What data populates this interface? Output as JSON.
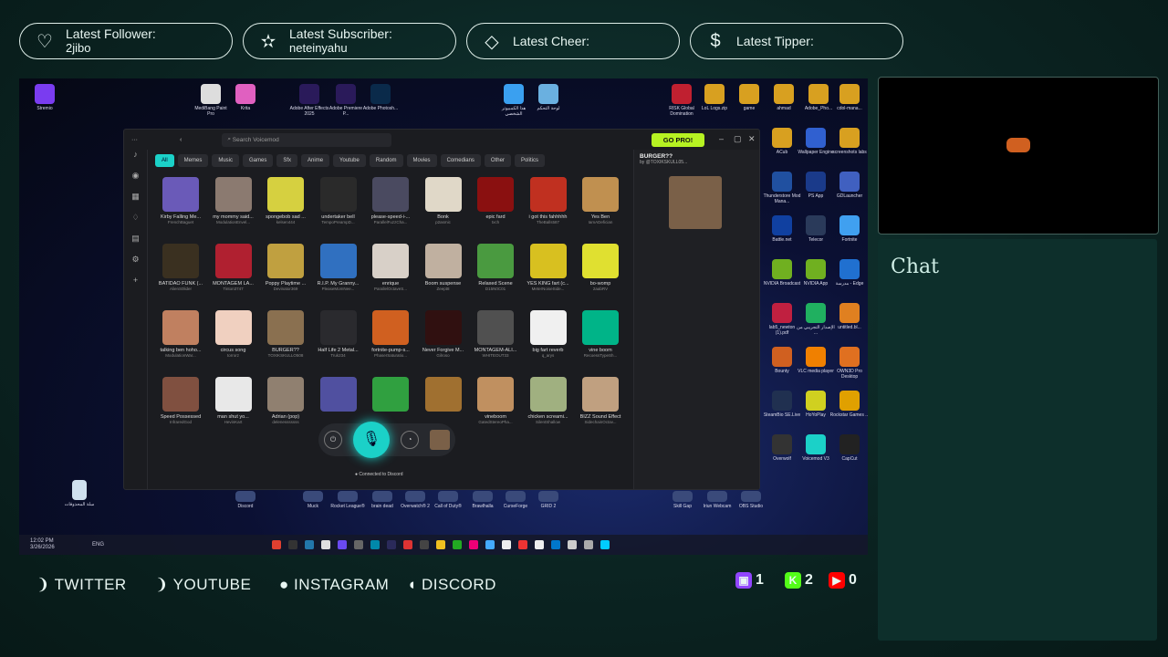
{
  "alerts": [
    {
      "icon": "heart-icon",
      "label": "Latest Follower:",
      "value": "2jibo",
      "glyph": "♡"
    },
    {
      "icon": "star-icon",
      "label": "Latest Subscriber:",
      "value": "neteinyahu",
      "glyph": "✫"
    },
    {
      "icon": "diamond-icon",
      "label": "Latest Cheer:",
      "value": "",
      "glyph": "◇"
    },
    {
      "icon": "dollar-icon",
      "label": "Latest Tipper:",
      "value": "",
      "glyph": "$"
    }
  ],
  "chat_label": "Chat",
  "socials": [
    {
      "icon": "twitter-icon",
      "glyph": "❩",
      "label": "TWITTER"
    },
    {
      "icon": "youtube-icon",
      "glyph": "❩",
      "label": "YOUTUBE"
    },
    {
      "icon": "instagram-icon",
      "glyph": "●",
      "label": "INSTAGRAM"
    },
    {
      "icon": "discord-icon",
      "glyph": "◖",
      "label": "DISCORD"
    }
  ],
  "counts": [
    {
      "icon": "twitch-icon",
      "value": "1",
      "color": "#9146ff"
    },
    {
      "icon": "kick-icon",
      "value": "2",
      "color": "#53fc18"
    },
    {
      "icon": "youtube-icon",
      "value": "0",
      "color": "#ff0000"
    }
  ],
  "desktop": {
    "top_icons": [
      "Stremio",
      "MediBang Paint Pro",
      "Krita",
      "Adobe After Effects 2025",
      "Adobe Premiere P...",
      "Adobe Photosh...",
      "هذا الكمبيوتر الشخصي",
      "لوحة التحكم",
      "RISK Global Domination",
      "LoL Logs.zip",
      "game",
      "ahmad",
      "Adobe_Pho...",
      "cdol-mana..."
    ],
    "right_icons": [
      "ACub",
      "Wallpaper Engine",
      "screenshots labs",
      "Thunderstore Mod Mana...",
      "PS App",
      "GDLauncher",
      "Battle.net",
      "Telecor",
      "Fortnite",
      "NVIDIA Broadcast",
      "NVIDIA App",
      "مدرسة - Edge",
      "lab5_newton (1).pdf",
      "الإصدار التجريبي من ...",
      "untitled.bl...",
      "Bounty",
      "VLC media player",
      "OWN3D Pro Desktop",
      "SteamBio SE.Live",
      "HoYoPlay",
      "Rockstar Games ...",
      "Overwolf",
      "Voicemod V3",
      "CapCut"
    ],
    "bottom_icons": [
      "Discord",
      "Muck",
      "Rocket League®",
      "brain dead",
      "Overwatch® 2",
      "Call of Duty®",
      "Brawlhalla",
      "CurseForge",
      "GRID 2",
      "Skill Gap",
      "Iriun Webcam",
      "OBS Studio"
    ],
    "recycle": "سلة المحذوفات",
    "clock": "12:02 PM",
    "date": "3/26/2026",
    "lang": "ENG"
  },
  "voicemod": {
    "search_placeholder": "Search Voicemod",
    "go_pro": "GO PRO!",
    "categories": [
      "All",
      "Memes",
      "Music",
      "Games",
      "Sfx",
      "Anime",
      "Youtube",
      "Random",
      "Movies",
      "Comedians",
      "Other",
      "Politics"
    ],
    "sounds": [
      {
        "name": "Kirby Falling Me...",
        "author": "FrenchBaguet",
        "color": "#6a5ab8"
      },
      {
        "name": "my mommy said...",
        "author": "ModulationEnvel...",
        "color": "#8b7a70"
      },
      {
        "name": "spongebob sad ...",
        "author": "kelsen444",
        "color": "#d6d040"
      },
      {
        "name": "undertaker bell",
        "author": "TempoPreampD...",
        "color": "#2a2a2a"
      },
      {
        "name": "please-speed-i-...",
        "author": "ParallelFuzzCha...",
        "color": "#4a4a60"
      },
      {
        "name": "Bonk",
        "author": "p2asmic",
        "color": "#e0d8c8"
      },
      {
        "name": "epic fard",
        "author": "txch",
        "color": "#8a1010"
      },
      {
        "name": "i got this fahhhhh",
        "author": "TheBalls587",
        "color": "#c03020"
      },
      {
        "name": "Yes Ben",
        "author": "IamADefician",
        "color": "#c09050"
      },
      {
        "name": "BATIDAO FUNK (...",
        "author": "AlienS0lider",
        "color": "#3a3020"
      },
      {
        "name": "MONTAGEM LA...",
        "author": "Tinton3747",
        "color": "#b02030"
      },
      {
        "name": "Poppy Playtime ...",
        "author": "Devinator369",
        "color": "#c0a040"
      },
      {
        "name": "R.I.P. My Granny...",
        "author": "PleaseMomNee...",
        "color": "#3070c0"
      },
      {
        "name": "enrique",
        "author": "ParallelOctaveS...",
        "color": "#d8d0c8"
      },
      {
        "name": "Boom suspense",
        "author": "Zeept8",
        "color": "#c0b0a0"
      },
      {
        "name": "Relaxed Scene",
        "author": "D15N0C01",
        "color": "#4a9a40"
      },
      {
        "name": "YES KING fart (c...",
        "author": "MeterNoiseSide...",
        "color": "#d8c020"
      },
      {
        "name": "bo-womp",
        "author": "2aabRV",
        "color": "#e0e030"
      },
      {
        "name": "talking ben hoho...",
        "author": "ModulationWar...",
        "color": "#c08060"
      },
      {
        "name": "circus song",
        "author": "torrorz",
        "color": "#f0d0c0"
      },
      {
        "name": "BURGER??",
        "author": "TOXIKSKULLO508",
        "color": "#8a7050"
      },
      {
        "name": "Half Life 2 Metal...",
        "author": "Truk234",
        "color": "#2a2a2e"
      },
      {
        "name": "fortnite-pump-s...",
        "author": "PhaserSaturatio...",
        "color": "#d06020"
      },
      {
        "name": "Never Forgive M...",
        "author": "Gilroso",
        "color": "#301010"
      },
      {
        "name": "MONTAGEM-ALI...",
        "author": "WHITEOUT33",
        "color": "#505050"
      },
      {
        "name": "big fart reverb",
        "author": "q_arys",
        "color": "#f0f0f0"
      },
      {
        "name": "vine boom",
        "author": "RecoessTypeSh...",
        "color": "#00b488"
      },
      {
        "name": "Speed Possessed",
        "author": "InfraredGod",
        "color": "#805040"
      },
      {
        "name": "man shut yo...",
        "author": "HevinKart",
        "color": "#e8e8e8"
      },
      {
        "name": "Adrian (pop)",
        "author": "delenesssssss",
        "color": "#908070"
      },
      {
        "name": "",
        "author": "",
        "color": "#5050a0"
      },
      {
        "name": "",
        "author": "",
        "color": "#30a040"
      },
      {
        "name": "",
        "author": "",
        "color": "#a07030"
      },
      {
        "name": "vineboom",
        "author": "GatedStereoPha...",
        "color": "#c09060"
      },
      {
        "name": "chicken screami...",
        "author": "SilentShallow",
        "color": "#a0b080"
      },
      {
        "name": "BIZZ Sound Effect",
        "author": "SidechainOctav...",
        "color": "#c0a080"
      }
    ],
    "selected_title": "BURGER??",
    "selected_by": "by @TOXIKSKULL05...",
    "discord_status": "Connected to Discord"
  }
}
